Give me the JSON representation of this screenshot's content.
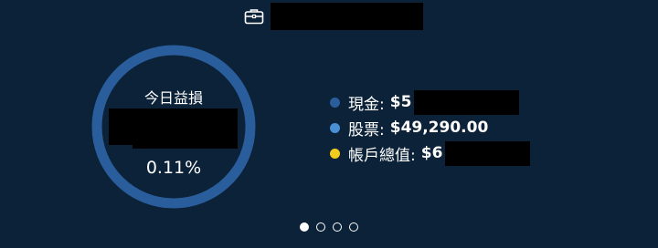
{
  "header": {
    "icon": "briefcase-icon"
  },
  "summary": {
    "title": "今日益損",
    "percent": "0.11%"
  },
  "allocation": {
    "cash_fraction": 0.93,
    "stock_fraction": 0.07
  },
  "legend": {
    "items": [
      {
        "label": "現金:",
        "value": "$5",
        "color": "#2a5d9c"
      },
      {
        "label": "股票:",
        "value": "$49,290.00",
        "color": "#4a8fd4"
      },
      {
        "label": "帳戶總值:",
        "value": "$6",
        "color": "#f2cc1d"
      }
    ]
  },
  "pager": {
    "count": 4,
    "active_index": 0
  },
  "colors": {
    "background": "#0c2238",
    "cash": "#2a5d9c",
    "stock": "#4a8fd4",
    "total": "#f2cc1d"
  }
}
